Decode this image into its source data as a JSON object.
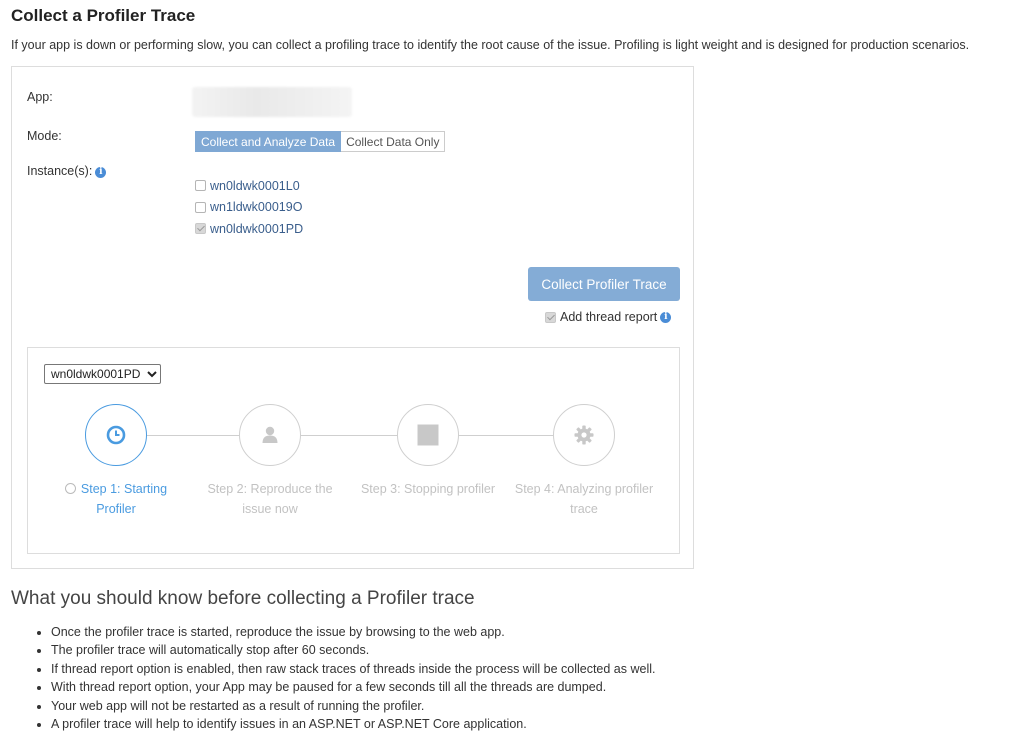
{
  "header": {
    "title": "Collect a Profiler Trace",
    "subtitle": "If your app is down or performing slow, you can collect a profiling trace to identify the root cause of the issue. Profiling is light weight and is designed for production scenarios."
  },
  "form": {
    "app_label": "App:",
    "mode_label": "Mode:",
    "mode_options": [
      "Collect and Analyze Data",
      "Collect Data Only"
    ],
    "mode_selected": "Collect and Analyze Data",
    "instances_label": "Instance(s):",
    "instances": [
      {
        "name": "wn0ldwk0001L0",
        "checked": false
      },
      {
        "name": "wn1ldwk00019O",
        "checked": false
      },
      {
        "name": "wn0ldwk0001PD",
        "checked": true
      }
    ],
    "collect_button": "Collect Profiler Trace",
    "thread_report_label": "Add thread report",
    "thread_report_checked": true
  },
  "steps_panel": {
    "selected_instance": "wn0ldwk0001PD",
    "steps": [
      {
        "label": "Step 1: Starting Profiler",
        "icon": "clock-icon",
        "active": true
      },
      {
        "label": "Step 2: Reproduce the issue now",
        "icon": "user-icon",
        "active": false
      },
      {
        "label": "Step 3: Stopping profiler",
        "icon": "stop-icon",
        "active": false
      },
      {
        "label": "Step 4: Analyzing profiler trace",
        "icon": "gear-icon",
        "active": false
      }
    ]
  },
  "know": {
    "title": "What you should know before collecting a Profiler trace",
    "items": [
      "Once the profiler trace is started, reproduce the issue by browsing to the web app.",
      "The profiler trace will automatically stop after 60 seconds.",
      "If thread report option is enabled, then raw stack traces of threads inside the process will be collected as well.",
      "With thread report option, your App may be paused for a few seconds till all the threads are dumped.",
      "Your web app will not be restarted as a result of running the profiler.",
      "A profiler trace will help to identify issues in an ASP.NET or ASP.NET Core application."
    ]
  },
  "colors": {
    "accent": "#4a9be0",
    "button": "#84acd6",
    "mode_active": "#7fa8d4",
    "inactive_step": "#c2c2c2"
  }
}
